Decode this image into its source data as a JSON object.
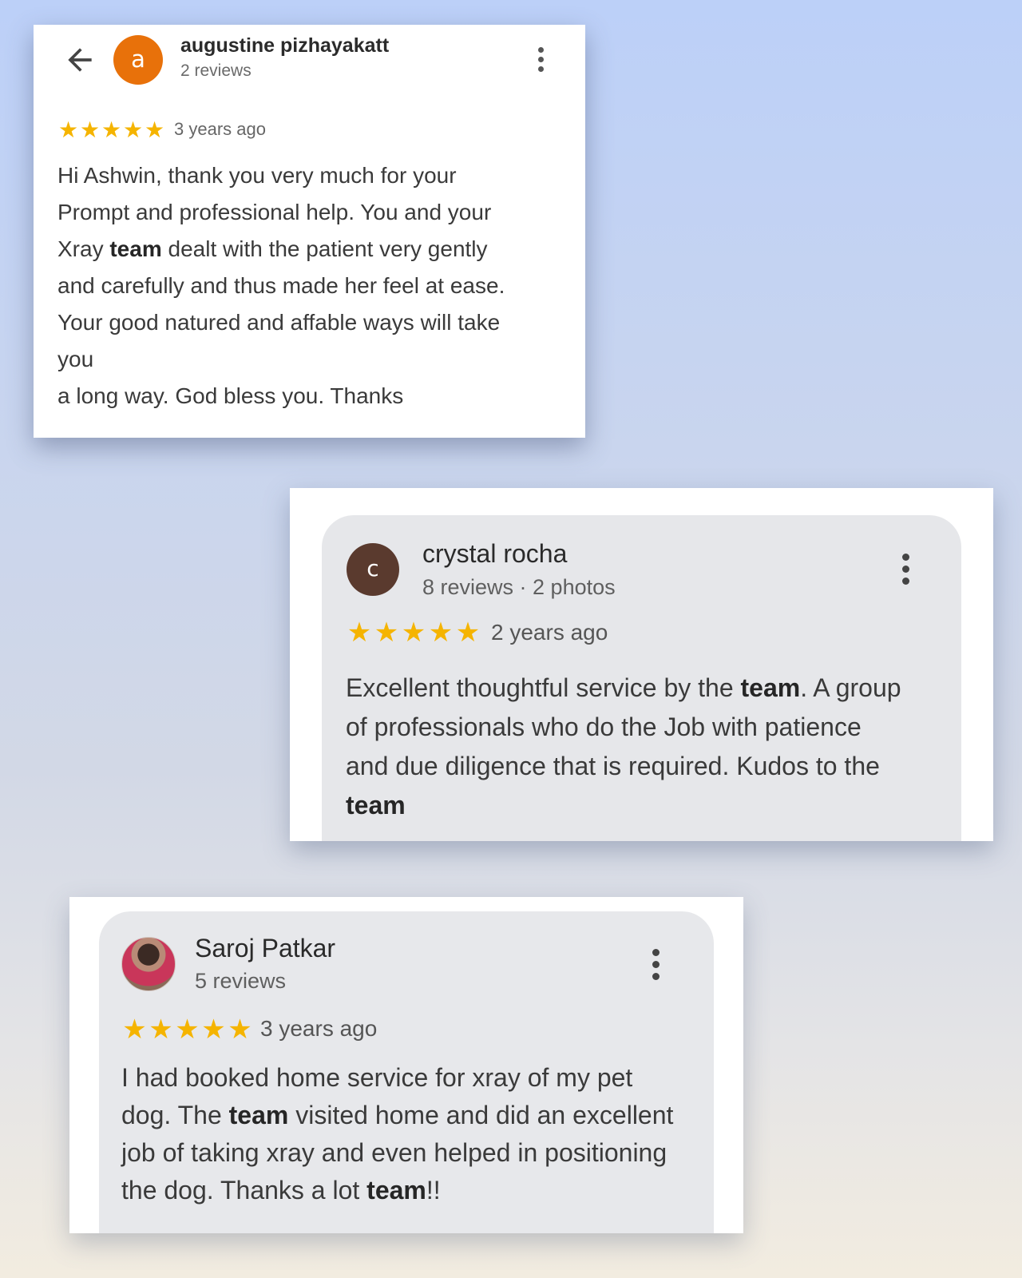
{
  "reviews": [
    {
      "reviewer": "augustine pizhayakatt",
      "avatar_letter": "a",
      "meta": "2 reviews",
      "rating": 5,
      "date": "3 years ago",
      "body_parts": [
        "Hi Ashwin, thank you very much for your\nPrompt and professional help. You and your\nXray ",
        "team",
        " dealt with the patient very gently\nand carefully and thus made her feel at ease.\nYour good natured and affable ways will take\nyou\na long way. God bless you. Thanks"
      ],
      "avatar_color": "#e8710a"
    },
    {
      "reviewer": "crystal rocha",
      "avatar_letter": "c",
      "meta": "8 reviews · 2 photos",
      "rating": 5,
      "date": "2 years ago",
      "body_parts": [
        "Excellent thoughtful service by the ",
        "team",
        ". A group\nof professionals who do the Job with patience\nand due diligence that is required. Kudos to the\n",
        "team"
      ],
      "avatar_color": "#5a3a2e"
    },
    {
      "reviewer": "Saroj Patkar",
      "meta": "5 reviews",
      "rating": 5,
      "date": "3 years ago",
      "body_parts": [
        "I had booked home service for xray of my pet\ndog. The ",
        "team",
        " visited home and did an excellent\njob of taking xray and even helped in positioning\nthe dog. Thanks a lot ",
        "team",
        "!!"
      ]
    }
  ],
  "icons": {
    "back": "arrow-left-icon",
    "more": "more-vert-icon",
    "star": "star-icon"
  },
  "colors": {
    "star": "#f5b400"
  }
}
